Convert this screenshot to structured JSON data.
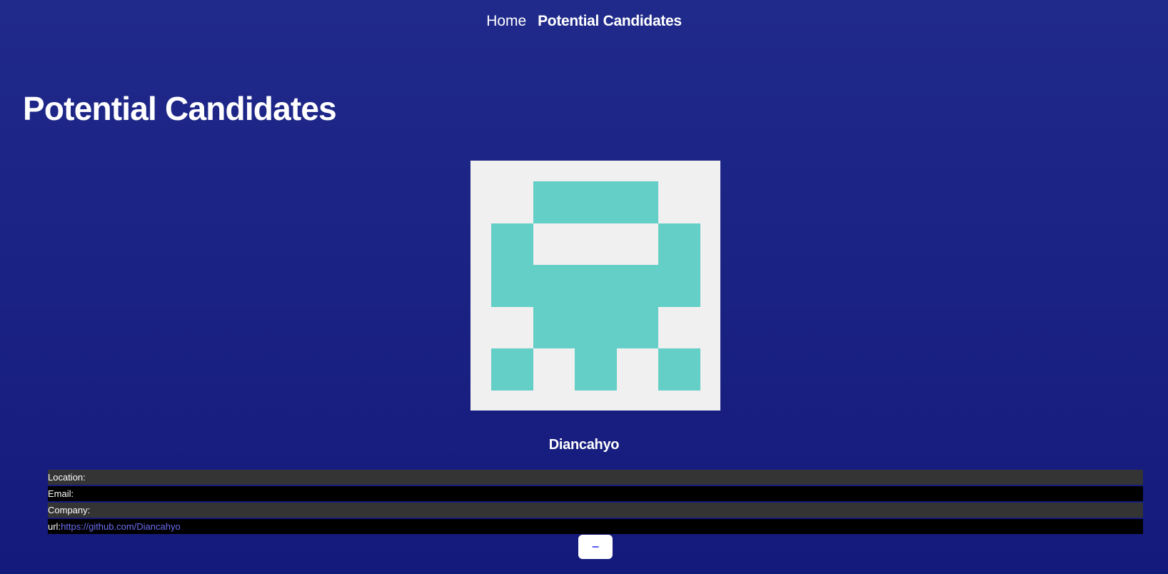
{
  "nav": {
    "home_label": "Home",
    "candidates_label": "Potential Candidates"
  },
  "main": {
    "title": "Potential Candidates"
  },
  "candidate": {
    "name": "Diancahyo",
    "avatar_colors": {
      "background": "#f0f0f0",
      "foreground": "#63cfc6"
    },
    "details": {
      "location_label": "Location:",
      "location_value": "",
      "email_label": "Email:",
      "email_value": "",
      "company_label": "Company:",
      "company_value": "",
      "url_label": "url:",
      "url_value": "https://github.com/Diancahyo"
    },
    "reject_label": "−"
  },
  "colors": {
    "background_top": "#202a8a",
    "background_bottom": "#141a7c",
    "row_dark": "#343434",
    "row_black": "#000000",
    "link": "#6a6cf0"
  }
}
